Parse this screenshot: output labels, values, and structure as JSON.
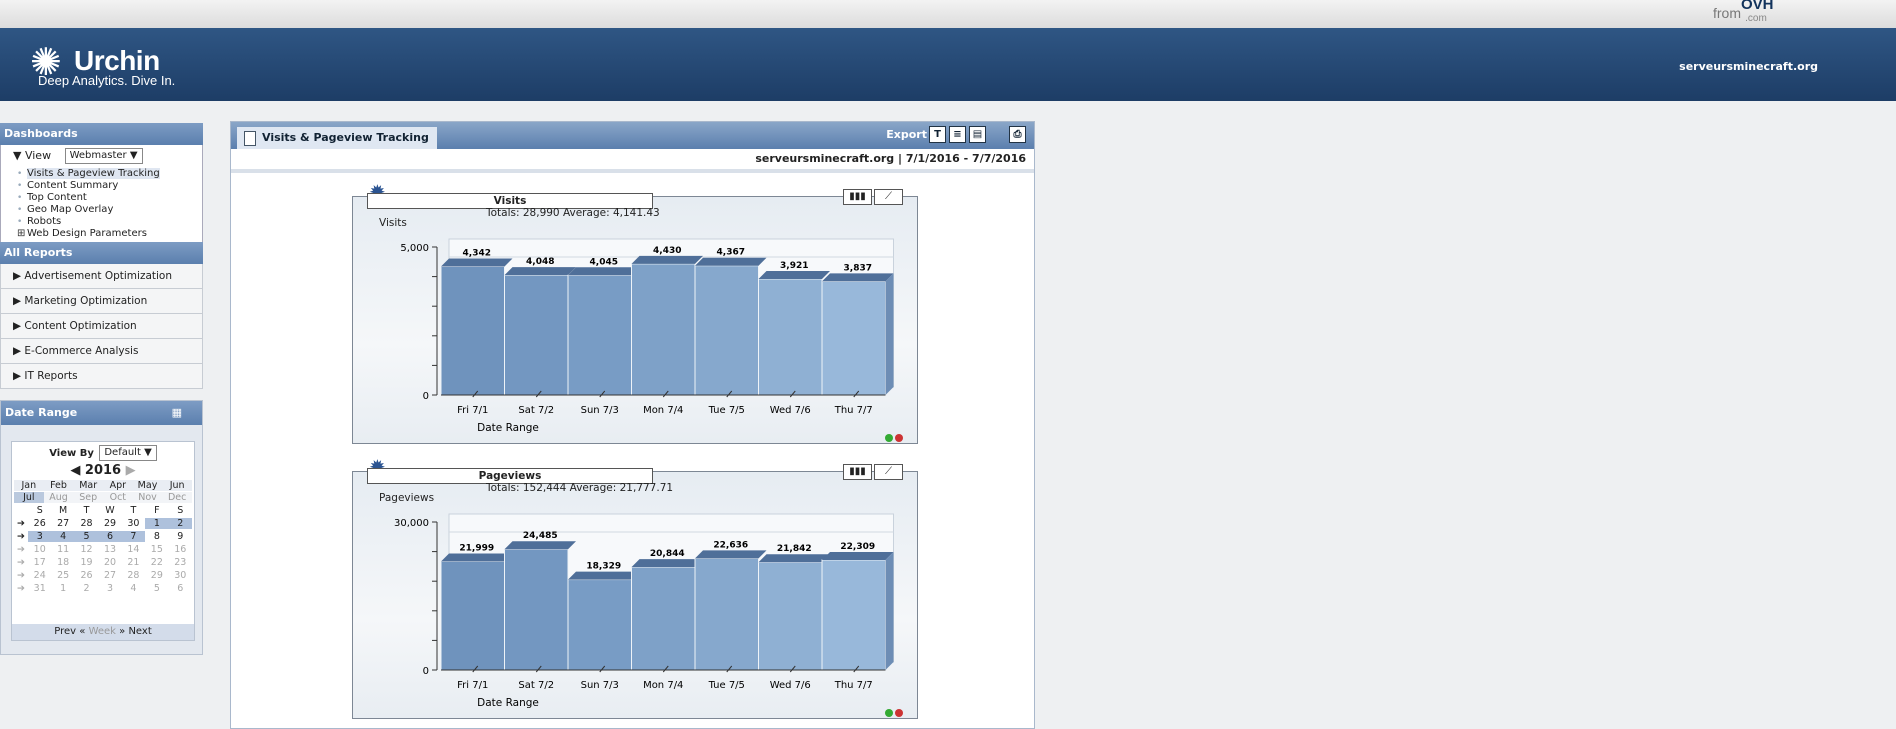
{
  "header": {
    "from_text": "from",
    "ovh_logo": "OVH",
    "ovh_domain": ".com",
    "brand": "Urchin",
    "tagline": "Deep Analytics. Dive In.",
    "site": "serveursminecraft.org"
  },
  "sidebar": {
    "dashboards_title": "Dashboards",
    "view_label": "View",
    "view_value": "Webmaster",
    "items": [
      "Visits & Pageview Tracking",
      "Content Summary",
      "Top Content",
      "Geo Map Overlay",
      "Robots",
      "Web Design Parameters"
    ],
    "all_reports_title": "All Reports",
    "reports": [
      "Advertisement Optimization",
      "Marketing Optimization",
      "Content Optimization",
      "E-Commerce Analysis",
      "IT Reports"
    ]
  },
  "date_range": {
    "title": "Date Range",
    "view_by_label": "View By",
    "view_by_value": "Default",
    "year": "2016",
    "months": [
      "Jan",
      "Feb",
      "Mar",
      "Apr",
      "May",
      "Jun",
      "Jul",
      "Aug",
      "Sep",
      "Oct",
      "Nov",
      "Dec"
    ],
    "weekdays": [
      "S",
      "M",
      "T",
      "W",
      "T",
      "F",
      "S"
    ],
    "weeks": [
      [
        "26",
        "27",
        "28",
        "29",
        "30",
        "1",
        "2"
      ],
      [
        "3",
        "4",
        "5",
        "6",
        "7",
        "8",
        "9"
      ],
      [
        "10",
        "11",
        "12",
        "13",
        "14",
        "15",
        "16"
      ],
      [
        "17",
        "18",
        "19",
        "20",
        "21",
        "22",
        "23"
      ],
      [
        "24",
        "25",
        "26",
        "27",
        "28",
        "29",
        "30"
      ],
      [
        "31",
        "1",
        "2",
        "3",
        "4",
        "5",
        "6"
      ]
    ],
    "prev": "Prev",
    "week": "Week",
    "next": "Next"
  },
  "main": {
    "tab_title": "Visits & Pageview Tracking",
    "export_label": "Export",
    "info": "serveursminecraft.org  |  7/1/2016 - 7/7/2016"
  },
  "chart_data": [
    {
      "type": "bar",
      "title": "Visits",
      "totals": "Totals: 28,990   Average: 4,141.43",
      "ylabel": "Visits",
      "xlabel": "Date Range",
      "categories": [
        "Fri 7/1",
        "Sat 7/2",
        "Sun 7/3",
        "Mon 7/4",
        "Tue 7/5",
        "Wed 7/6",
        "Thu 7/7"
      ],
      "values": [
        4342,
        4048,
        4045,
        4430,
        4367,
        3921,
        3837
      ],
      "value_labels": [
        "4,342",
        "4,048",
        "4,045",
        "4,430",
        "4,367",
        "3,921",
        "3,837"
      ],
      "ylim": [
        0,
        5000
      ],
      "ytick_labels": [
        "0",
        "5,000"
      ]
    },
    {
      "type": "bar",
      "title": "Pageviews",
      "totals": "Totals: 152,444   Average: 21,777.71",
      "ylabel": "Pageviews",
      "xlabel": "Date Range",
      "categories": [
        "Fri 7/1",
        "Sat 7/2",
        "Sun 7/3",
        "Mon 7/4",
        "Tue 7/5",
        "Wed 7/6",
        "Thu 7/7"
      ],
      "values": [
        21999,
        24485,
        18329,
        20844,
        22636,
        21842,
        22309
      ],
      "value_labels": [
        "21,999",
        "24,485",
        "18,329",
        "20,844",
        "22,636",
        "21,842",
        "22,309"
      ],
      "ylim": [
        0,
        30000
      ],
      "ytick_labels": [
        "0",
        "30,000"
      ]
    }
  ],
  "colors": {
    "banner": "#1d3d66",
    "bar_front": "#7d9ec7",
    "bar_top": "#4f6f99"
  }
}
